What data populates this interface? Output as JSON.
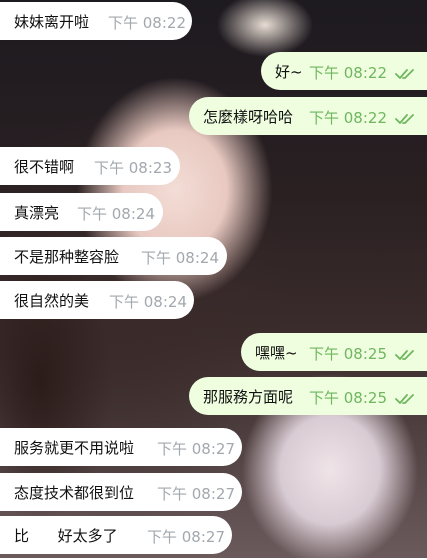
{
  "messages": [
    {
      "dir": "in",
      "text": "妹妹离开啦",
      "time": "下午 08:22"
    },
    {
      "dir": "out",
      "text": "好~",
      "time": "下午 08:22"
    },
    {
      "dir": "out",
      "text": "怎麼樣呀哈哈",
      "time": "下午 08:22"
    },
    {
      "dir": "in",
      "text": "很不错啊",
      "time": "下午 08:23"
    },
    {
      "dir": "in",
      "text": "真漂亮",
      "time": "下午 08:24"
    },
    {
      "dir": "in",
      "text": "不是那种整容脸",
      "time": "下午 08:24"
    },
    {
      "dir": "in",
      "text": "很自然的美",
      "time": "下午 08:24"
    },
    {
      "dir": "out",
      "text": "嘿嘿~",
      "time": "下午 08:25"
    },
    {
      "dir": "out",
      "text": "那服務方面呢",
      "time": "下午 08:25"
    },
    {
      "dir": "in",
      "text": "服务就更不用说啦",
      "time": "下午 08:27"
    },
    {
      "dir": "in",
      "text": "态度技术都很到位",
      "time": "下午 08:27"
    },
    {
      "dir": "in",
      "text": "比      好太多了",
      "time": "下午 08:27"
    }
  ],
  "colors": {
    "incoming": "#ffffff",
    "outgoing": "#eefedf",
    "read_check": "#6fb65e"
  },
  "icons": {
    "read_receipt": "double-check-icon"
  }
}
